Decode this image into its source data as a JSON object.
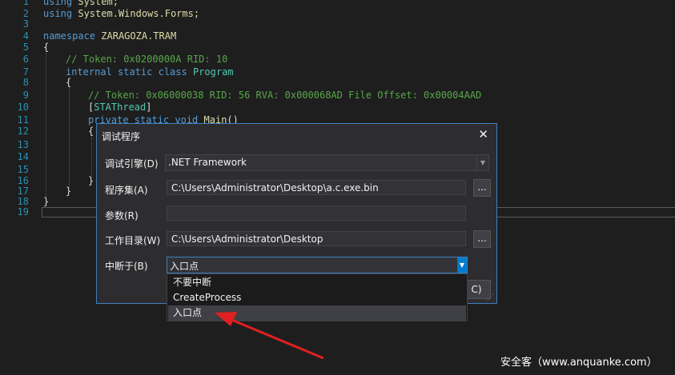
{
  "editor": {
    "lines": [
      {
        "n": "1"
      },
      {
        "n": "2"
      },
      {
        "n": "3"
      },
      {
        "n": "4"
      },
      {
        "n": "5"
      },
      {
        "n": "6"
      },
      {
        "n": "7"
      },
      {
        "n": "8"
      },
      {
        "n": "9"
      },
      {
        "n": "10"
      },
      {
        "n": "11"
      },
      {
        "n": "12"
      },
      {
        "n": "13"
      },
      {
        "n": "14"
      },
      {
        "n": "15"
      },
      {
        "n": "16"
      },
      {
        "n": "17"
      },
      {
        "n": "18"
      },
      {
        "n": "19"
      }
    ],
    "code": {
      "l1_kw": "using",
      "l1_ns": "System;",
      "l2_kw": "using",
      "l2_ns": "System.Windows.Forms;",
      "l4_kw": "namespace",
      "l4_ns": "ZARAGOZA.TRAM",
      "l5": "{",
      "l6_cm": "// Token: 0x0200000A RID: 10",
      "l7_kw": "internal static class",
      "l7_ty": "Program",
      "l8": "{",
      "l9_cm": "// Token: 0x06000038 RID: 56 RVA: 0x000068AD File Offset: 0x00004AAD",
      "l10_a": "[",
      "l10_at": "STAThread",
      "l10_b": "]",
      "l11_kw": "private static void",
      "l11_fn": "Main",
      "l11_p": "()",
      "l12": "{",
      "l16": "}",
      "l17": "}",
      "l18": "}"
    }
  },
  "dialog": {
    "title": "调试程序",
    "close": "✕",
    "engine_label": "调试引擎(D)",
    "engine_value": ".NET Framework",
    "assembly_label": "程序集(A)",
    "assembly_value": "C:\\Users\\Administrator\\Desktop\\a.c.exe.bin",
    "args_label": "参数(R)",
    "args_value": "",
    "workdir_label": "工作目录(W)",
    "workdir_value": "C:\\Users\\Administrator\\Desktop",
    "break_label": "中断于(B)",
    "break_value": "入口点",
    "browse": "...",
    "ok_partial": "C)"
  },
  "dropdown": {
    "options": [
      "不要中断",
      "CreateProcess",
      "入口点"
    ],
    "selected_index": 2
  },
  "watermark": "安全客（www.anquanke.com）",
  "colors": {
    "accent": "#007acc",
    "arrow": "#e02020",
    "bg": "#1e1e1e",
    "dialog": "#2d2d30"
  }
}
